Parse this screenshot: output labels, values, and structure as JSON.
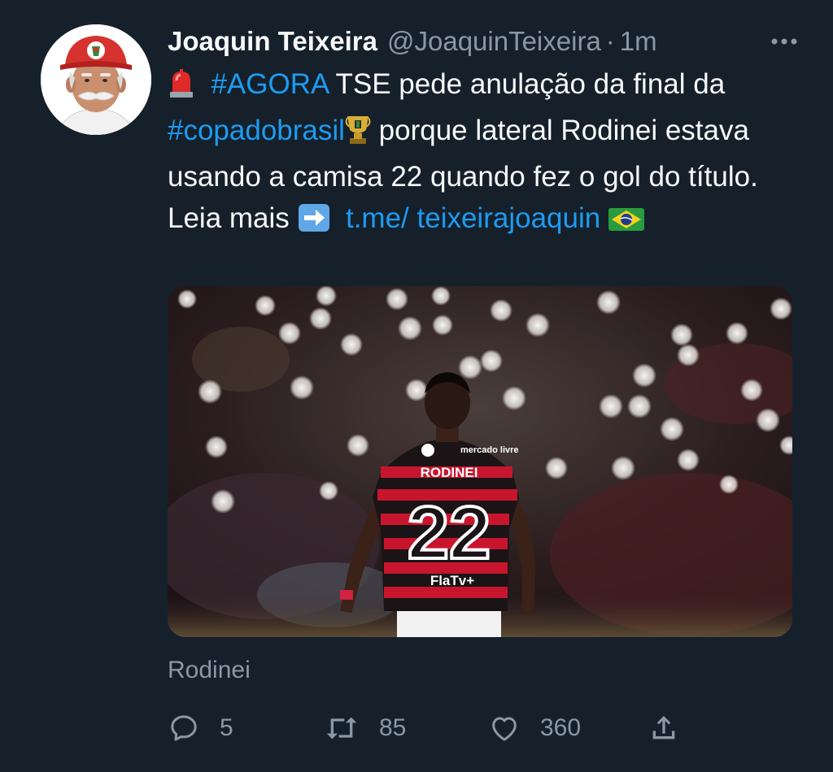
{
  "author": {
    "display_name": "Joaquin Teixeira",
    "handle": "@JoaquinTeixeira",
    "separator": "·",
    "time": "1m"
  },
  "tweet": {
    "emoji_siren": "siren-emoji",
    "hashtag_agora": "#AGORA",
    "text_1": " TSE pede anulação da final da ",
    "hashtag_copa": "#copadobrasil",
    "emoji_trophy": "trophy-emoji",
    "text_2": " porque lateral Rodinei estava usando a camisa 22 quando fez o gol do título. Leia mais ",
    "emoji_arrow": "right-arrow-emoji",
    "link_text": "t.me/ teixeirajoaquin",
    "emoji_flag": "brazil-flag-emoji"
  },
  "media": {
    "shirt_name": "RODINEI",
    "shirt_number": "22",
    "sponsor_top": "mercado livre",
    "sponsor_bottom": "FlaTv+"
  },
  "caption": "Rodinei",
  "actions": {
    "reply_count": "5",
    "retweet_count": "85",
    "like_count": "360"
  },
  "colors": {
    "background": "#15202b",
    "text": "#f7f9f9",
    "muted": "#8b98a5",
    "accent": "#1d9bf0"
  }
}
